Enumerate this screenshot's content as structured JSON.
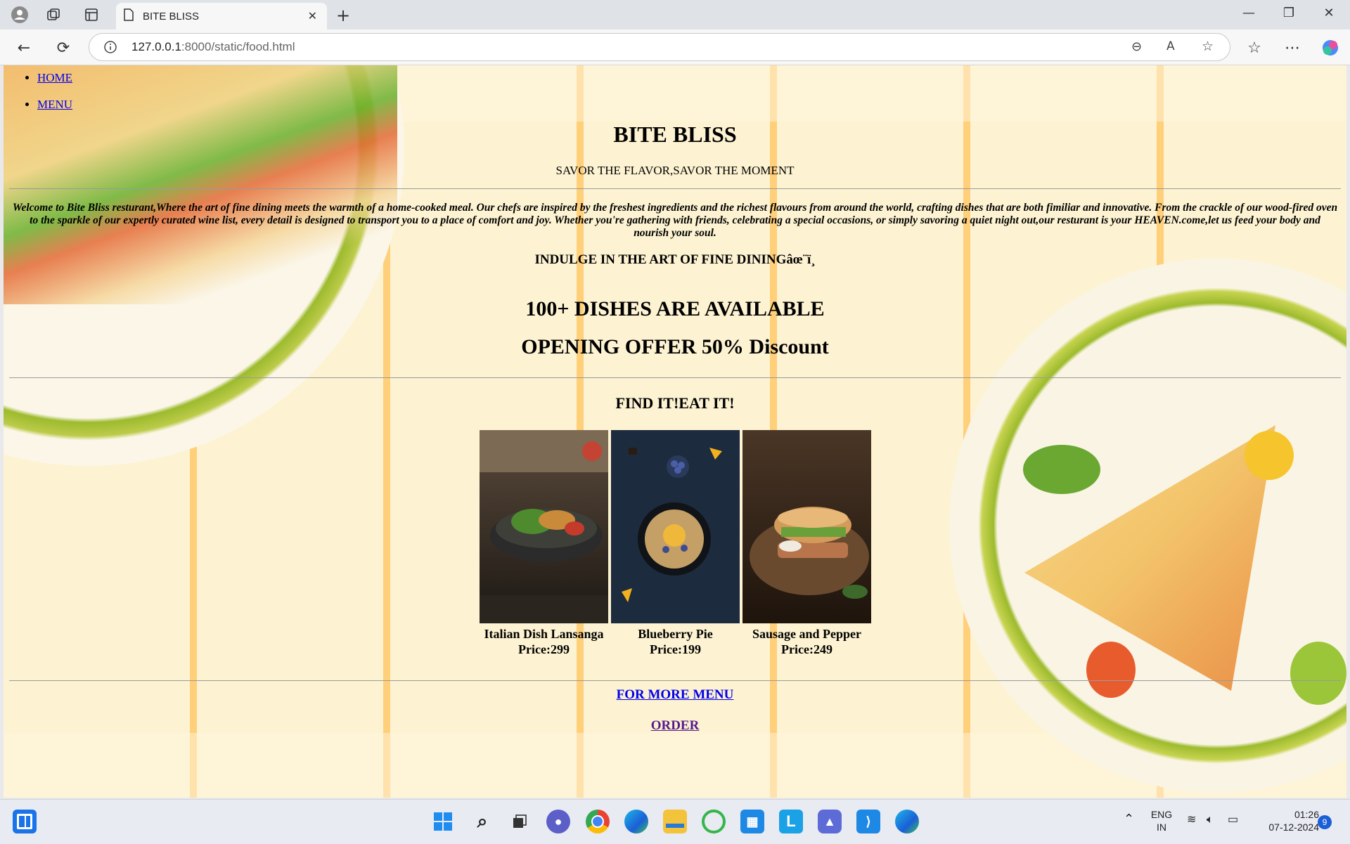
{
  "browser": {
    "tab_title": "BITE BLISS",
    "url_host": "127.0.0.1",
    "url_path": ":8000/static/food.html"
  },
  "page": {
    "nav": [
      "HOME",
      "MENU"
    ],
    "title": "BITE BLISS",
    "tagline": "SAVOR THE FLAVOR,SAVOR THE MOMENT",
    "welcome": "Welcome to Bite Bliss resturant,Where the art of fine dining meets the warmth of a home-cooked meal. Our chefs are inspired by the freshest ingredients and the richest flavours from around the world, crafting dishes that are both fimiliar and innovative. From the crackle of our wood-fired oven to the sparkle of our expertly curated wine list, every detail is designed to transport you to a place of comfort and joy. Whether you're gathering with friends, celebrating a special occasions, or simply savoring a quiet night out,our resturant is your HEAVEN.come,let us feed your body and nourish your soul.",
    "indulge": "INDULGE IN THE ART OF FINE DININGâœ¨ï¸",
    "dishes_available": "100+ DISHES ARE AVAILABLE",
    "offer": "OPENING OFFER 50% Discount",
    "find": "FIND IT!EAT IT!",
    "items": [
      {
        "name": "Italian Dish Lansanga",
        "price": "Price:299"
      },
      {
        "name": "Blueberry Pie",
        "price": "Price:199"
      },
      {
        "name": "Sausage and Pepper",
        "price": "Price:249"
      }
    ],
    "more_menu": "FOR MORE MENU",
    "order": "ORDER"
  },
  "taskbar": {
    "lang_top": "ENG",
    "lang_bottom": "IN",
    "time": "01:26",
    "date": "07-12-2024",
    "notification_count": "9"
  }
}
